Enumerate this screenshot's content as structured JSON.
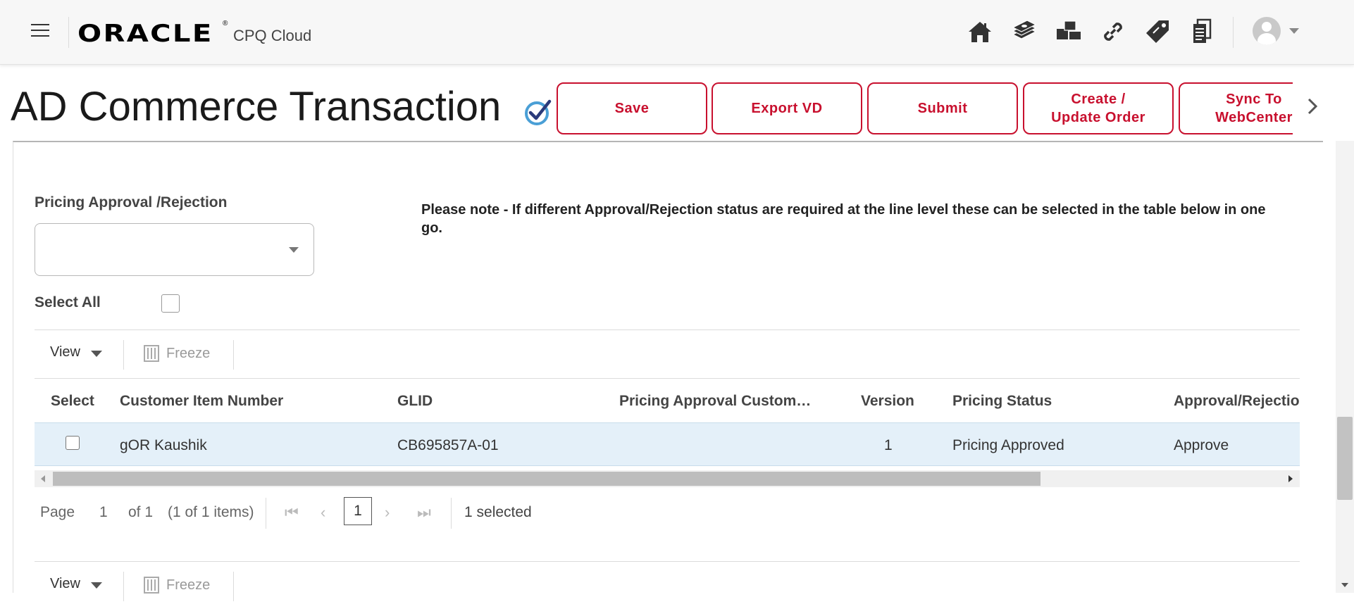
{
  "header": {
    "logo": "ORACLE",
    "logo_mark": "®",
    "product": "CPQ Cloud",
    "nav_icons": [
      "home-icon",
      "money-icon",
      "boxes-icon",
      "link-icon",
      "price-tag-icon",
      "documents-icon"
    ]
  },
  "page": {
    "title": "AD Commerce Transaction"
  },
  "actions": [
    {
      "label": "Save"
    },
    {
      "label": "Export VD"
    },
    {
      "label": "Submit"
    },
    {
      "label": "Create /\nUpdate Order"
    },
    {
      "label": "Sync To\nWebCenter"
    }
  ],
  "form": {
    "approval_label": "Pricing Approval /Rejection",
    "approval_value": "",
    "note": "Please note - If different Approval/Rejection status are required at the line level these can be selected in the table below in one go.",
    "select_all_label": "Select All"
  },
  "toolbar": {
    "view_label": "View",
    "freeze_label": "Freeze"
  },
  "grid": {
    "columns": [
      "Select",
      "Customer Item Number",
      "GLID",
      "Pricing Approval Custom…",
      "Version",
      "Pricing Status",
      "Approval/Rejection"
    ],
    "rows": [
      {
        "customer_item_number": "gOR Kaushik",
        "glid": "CB695857A-01",
        "pricing_approval_custom": "",
        "version": "1",
        "pricing_status": "Pricing Approved",
        "approval_rejection": "Approve"
      }
    ]
  },
  "pager": {
    "page_label": "Page",
    "page_number": "1",
    "of_label": "of 1",
    "items_label": "(1 of 1 items)",
    "current_page": "1",
    "selected_label": "1 selected"
  },
  "colors": {
    "accent": "#c8102e",
    "row_highlight": "#e4f0f9"
  }
}
